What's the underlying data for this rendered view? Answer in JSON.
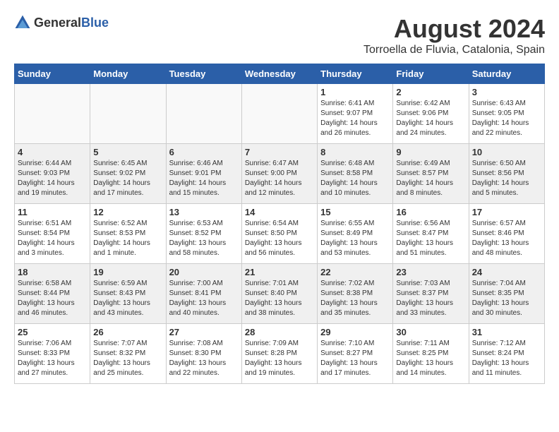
{
  "logo": {
    "general": "General",
    "blue": "Blue"
  },
  "title": "August 2024",
  "subtitle": "Torroella de Fluvia, Catalonia, Spain",
  "weekdays": [
    "Sunday",
    "Monday",
    "Tuesday",
    "Wednesday",
    "Thursday",
    "Friday",
    "Saturday"
  ],
  "weeks": [
    [
      {
        "day": "",
        "info": ""
      },
      {
        "day": "",
        "info": ""
      },
      {
        "day": "",
        "info": ""
      },
      {
        "day": "",
        "info": ""
      },
      {
        "day": "1",
        "info": "Sunrise: 6:41 AM\nSunset: 9:07 PM\nDaylight: 14 hours\nand 26 minutes."
      },
      {
        "day": "2",
        "info": "Sunrise: 6:42 AM\nSunset: 9:06 PM\nDaylight: 14 hours\nand 24 minutes."
      },
      {
        "day": "3",
        "info": "Sunrise: 6:43 AM\nSunset: 9:05 PM\nDaylight: 14 hours\nand 22 minutes."
      }
    ],
    [
      {
        "day": "4",
        "info": "Sunrise: 6:44 AM\nSunset: 9:03 PM\nDaylight: 14 hours\nand 19 minutes."
      },
      {
        "day": "5",
        "info": "Sunrise: 6:45 AM\nSunset: 9:02 PM\nDaylight: 14 hours\nand 17 minutes."
      },
      {
        "day": "6",
        "info": "Sunrise: 6:46 AM\nSunset: 9:01 PM\nDaylight: 14 hours\nand 15 minutes."
      },
      {
        "day": "7",
        "info": "Sunrise: 6:47 AM\nSunset: 9:00 PM\nDaylight: 14 hours\nand 12 minutes."
      },
      {
        "day": "8",
        "info": "Sunrise: 6:48 AM\nSunset: 8:58 PM\nDaylight: 14 hours\nand 10 minutes."
      },
      {
        "day": "9",
        "info": "Sunrise: 6:49 AM\nSunset: 8:57 PM\nDaylight: 14 hours\nand 8 minutes."
      },
      {
        "day": "10",
        "info": "Sunrise: 6:50 AM\nSunset: 8:56 PM\nDaylight: 14 hours\nand 5 minutes."
      }
    ],
    [
      {
        "day": "11",
        "info": "Sunrise: 6:51 AM\nSunset: 8:54 PM\nDaylight: 14 hours\nand 3 minutes."
      },
      {
        "day": "12",
        "info": "Sunrise: 6:52 AM\nSunset: 8:53 PM\nDaylight: 14 hours\nand 1 minute."
      },
      {
        "day": "13",
        "info": "Sunrise: 6:53 AM\nSunset: 8:52 PM\nDaylight: 13 hours\nand 58 minutes."
      },
      {
        "day": "14",
        "info": "Sunrise: 6:54 AM\nSunset: 8:50 PM\nDaylight: 13 hours\nand 56 minutes."
      },
      {
        "day": "15",
        "info": "Sunrise: 6:55 AM\nSunset: 8:49 PM\nDaylight: 13 hours\nand 53 minutes."
      },
      {
        "day": "16",
        "info": "Sunrise: 6:56 AM\nSunset: 8:47 PM\nDaylight: 13 hours\nand 51 minutes."
      },
      {
        "day": "17",
        "info": "Sunrise: 6:57 AM\nSunset: 8:46 PM\nDaylight: 13 hours\nand 48 minutes."
      }
    ],
    [
      {
        "day": "18",
        "info": "Sunrise: 6:58 AM\nSunset: 8:44 PM\nDaylight: 13 hours\nand 46 minutes."
      },
      {
        "day": "19",
        "info": "Sunrise: 6:59 AM\nSunset: 8:43 PM\nDaylight: 13 hours\nand 43 minutes."
      },
      {
        "day": "20",
        "info": "Sunrise: 7:00 AM\nSunset: 8:41 PM\nDaylight: 13 hours\nand 40 minutes."
      },
      {
        "day": "21",
        "info": "Sunrise: 7:01 AM\nSunset: 8:40 PM\nDaylight: 13 hours\nand 38 minutes."
      },
      {
        "day": "22",
        "info": "Sunrise: 7:02 AM\nSunset: 8:38 PM\nDaylight: 13 hours\nand 35 minutes."
      },
      {
        "day": "23",
        "info": "Sunrise: 7:03 AM\nSunset: 8:37 PM\nDaylight: 13 hours\nand 33 minutes."
      },
      {
        "day": "24",
        "info": "Sunrise: 7:04 AM\nSunset: 8:35 PM\nDaylight: 13 hours\nand 30 minutes."
      }
    ],
    [
      {
        "day": "25",
        "info": "Sunrise: 7:06 AM\nSunset: 8:33 PM\nDaylight: 13 hours\nand 27 minutes."
      },
      {
        "day": "26",
        "info": "Sunrise: 7:07 AM\nSunset: 8:32 PM\nDaylight: 13 hours\nand 25 minutes."
      },
      {
        "day": "27",
        "info": "Sunrise: 7:08 AM\nSunset: 8:30 PM\nDaylight: 13 hours\nand 22 minutes."
      },
      {
        "day": "28",
        "info": "Sunrise: 7:09 AM\nSunset: 8:28 PM\nDaylight: 13 hours\nand 19 minutes."
      },
      {
        "day": "29",
        "info": "Sunrise: 7:10 AM\nSunset: 8:27 PM\nDaylight: 13 hours\nand 17 minutes."
      },
      {
        "day": "30",
        "info": "Sunrise: 7:11 AM\nSunset: 8:25 PM\nDaylight: 13 hours\nand 14 minutes."
      },
      {
        "day": "31",
        "info": "Sunrise: 7:12 AM\nSunset: 8:24 PM\nDaylight: 13 hours\nand 11 minutes."
      }
    ]
  ]
}
